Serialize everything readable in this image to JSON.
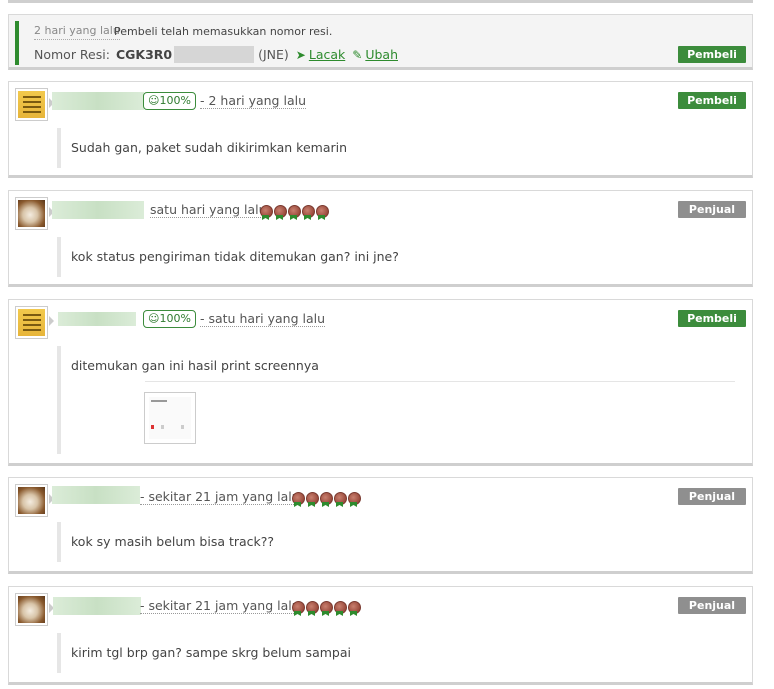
{
  "notice": {
    "time": "2 hari yang lalu",
    "message": "Pembeli telah memasukkan nomor resi.",
    "resi_label": "Nomor Resi:",
    "resi_number": "CGK3R0",
    "courier": "(JNE)",
    "track_label": "Lacak",
    "edit_label": "Ubah",
    "role": "Pembeli"
  },
  "comments": [
    {
      "role": "Pembeli",
      "rating": "100%",
      "time": "- 2 hari yang lalu",
      "text": "Sudah gan, paket sudah dikirimkan kemarin"
    },
    {
      "role": "Penjual",
      "time": "satu hari yang lalu",
      "text": "kok status pengiriman tidak ditemukan gan? ini jne?"
    },
    {
      "role": "Pembeli",
      "rating": "100%",
      "time": "- satu hari yang lalu",
      "text": "ditemukan gan ini hasil print screennya"
    },
    {
      "role": "Penjual",
      "time": "- sekitar 21 jam yang lalu",
      "text": "kok sy masih belum bisa track??"
    },
    {
      "role": "Penjual",
      "time": "- sekitar 21 jam yang lalu",
      "text": "kirim tgl brp gan? sampe skrg belum sampai"
    }
  ],
  "icons": {
    "rating": "smiley-icon",
    "track": "send-icon",
    "edit": "pencil-icon",
    "seller_badge": "medal-icon"
  },
  "colors": {
    "buyer": "#3c8c3c",
    "seller": "#8f8f8f",
    "link": "#2e8b2e"
  }
}
